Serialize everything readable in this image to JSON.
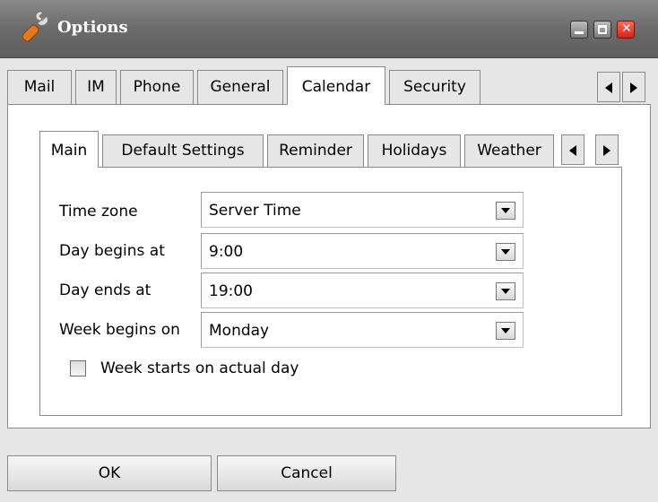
{
  "window": {
    "title": "Options",
    "icon": "wrench-icon"
  },
  "title_buttons": {
    "minimize": "minimize-icon",
    "maximize": "maximize-icon",
    "close": "✕"
  },
  "outer_tabs": [
    "Mail",
    "IM",
    "Phone",
    "General",
    "Calendar",
    "Security"
  ],
  "outer_active": "Calendar",
  "inner_tabs": [
    "Main",
    "Default Settings",
    "Reminder",
    "Holidays",
    "Weather"
  ],
  "inner_active": "Main",
  "form": {
    "time_zone": {
      "label": "Time zone",
      "value": "Server Time"
    },
    "day_begins": {
      "label": "Day begins at",
      "value": "9:00"
    },
    "day_ends": {
      "label": "Day ends at",
      "value": "19:00"
    },
    "week_begins": {
      "label": "Week begins on",
      "value": "Monday"
    },
    "week_actual_day": {
      "label": "Week starts on actual day",
      "checked": false
    }
  },
  "buttons": {
    "ok": "OK",
    "cancel": "Cancel"
  }
}
